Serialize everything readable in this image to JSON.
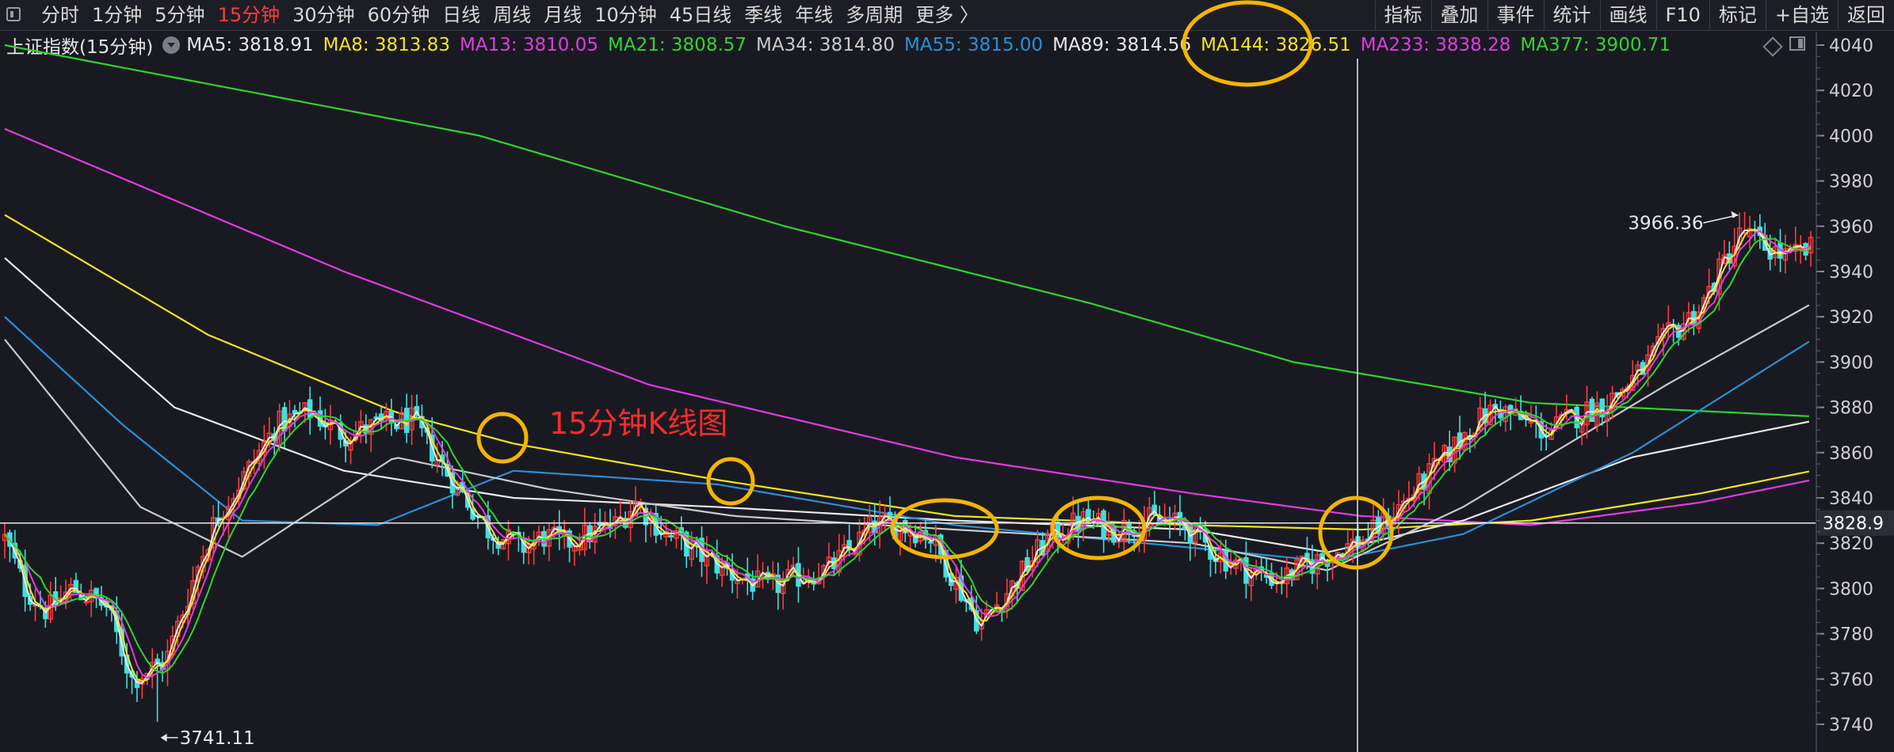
{
  "toolbar": {
    "periods": [
      {
        "label": "分时",
        "active": false
      },
      {
        "label": "1分钟",
        "active": false
      },
      {
        "label": "5分钟",
        "active": false
      },
      {
        "label": "15分钟",
        "active": true
      },
      {
        "label": "30分钟",
        "active": false
      },
      {
        "label": "60分钟",
        "active": false
      },
      {
        "label": "日线",
        "active": false
      },
      {
        "label": "周线",
        "active": false
      },
      {
        "label": "月线",
        "active": false
      },
      {
        "label": "10分钟",
        "active": false
      },
      {
        "label": "45日线",
        "active": false
      },
      {
        "label": "季线",
        "active": false
      },
      {
        "label": "年线",
        "active": false
      },
      {
        "label": "多周期",
        "active": false
      },
      {
        "label": "更多 〉",
        "active": false
      }
    ],
    "tools": [
      "指标",
      "叠加",
      "事件",
      "统计",
      "画线",
      "F10",
      "标记",
      "+自选",
      "返回"
    ]
  },
  "chart_title": "上证指数(15分钟)",
  "ma_legend": [
    {
      "label": "MA5: 3818.91",
      "color": "#e8e8e8"
    },
    {
      "label": "MA8: 3813.83",
      "color": "#f2e31c"
    },
    {
      "label": "MA13: 3810.05",
      "color": "#e13ae1"
    },
    {
      "label": "MA21: 3808.57",
      "color": "#2fd42f"
    },
    {
      "label": "MA34: 3814.80",
      "color": "#c9c9c9"
    },
    {
      "label": "MA55: 3815.00",
      "color": "#2a8fd6"
    },
    {
      "label": "MA89: 3814.56",
      "color": "#e8e8e8"
    },
    {
      "label": "MA144: 3826.51",
      "color": "#f2e31c"
    },
    {
      "label": "MA233: 3838.28",
      "color": "#e13ae1"
    },
    {
      "label": "MA377: 3900.71",
      "color": "#2fd42f"
    }
  ],
  "annotation_text": "15分钟K线图",
  "current_price_tag": "3828.9",
  "high_label": "3966.36",
  "low_label": "3741.11",
  "colors": {
    "up": "#ff3b3b",
    "down": "#3fe0e0",
    "circle": "#f5b400",
    "crosshair": "#e8e8e8"
  },
  "chart_data": {
    "type": "candlestick",
    "ylim": [
      3735,
      4048
    ],
    "y_ticks": [
      3740,
      3760,
      3780,
      3800,
      3820,
      3840,
      3860,
      3880,
      3900,
      3920,
      3940,
      3960,
      3980,
      4000,
      4020,
      4040
    ],
    "current_price": 3828.9,
    "high": 3966.36,
    "low": 3741.11,
    "price_path": [
      [
        0,
        3822
      ],
      [
        12,
        3800
      ],
      [
        25,
        3790
      ],
      [
        40,
        3800
      ],
      [
        60,
        3792
      ],
      [
        75,
        3760
      ],
      [
        95,
        3768
      ],
      [
        115,
        3812
      ],
      [
        125,
        3832
      ],
      [
        140,
        3848
      ],
      [
        160,
        3872
      ],
      [
        180,
        3878
      ],
      [
        200,
        3868
      ],
      [
        220,
        3872
      ],
      [
        240,
        3874
      ],
      [
        262,
        3850
      ],
      [
        285,
        3826
      ],
      [
        305,
        3818
      ],
      [
        318,
        3823
      ],
      [
        330,
        3820
      ],
      [
        345,
        3824
      ],
      [
        360,
        3828
      ],
      [
        372,
        3838
      ],
      [
        390,
        3824
      ],
      [
        410,
        3815
      ],
      [
        430,
        3806
      ],
      [
        450,
        3800
      ],
      [
        470,
        3806
      ],
      [
        485,
        3808
      ],
      [
        500,
        3818
      ],
      [
        512,
        3828
      ],
      [
        528,
        3828
      ],
      [
        545,
        3824
      ],
      [
        560,
        3804
      ],
      [
        575,
        3784
      ],
      [
        595,
        3802
      ],
      [
        615,
        3822
      ],
      [
        635,
        3830
      ],
      [
        655,
        3826
      ],
      [
        675,
        3830
      ],
      [
        695,
        3828
      ],
      [
        715,
        3815
      ],
      [
        735,
        3807
      ],
      [
        752,
        3804
      ],
      [
        770,
        3811
      ],
      [
        790,
        3818
      ],
      [
        805,
        3823
      ],
      [
        825,
        3838
      ],
      [
        845,
        3854
      ],
      [
        865,
        3872
      ],
      [
        880,
        3880
      ],
      [
        895,
        3874
      ],
      [
        910,
        3869
      ],
      [
        925,
        3876
      ],
      [
        945,
        3882
      ],
      [
        965,
        3896
      ],
      [
        980,
        3911
      ],
      [
        1000,
        3924
      ],
      [
        1015,
        3946
      ],
      [
        1025,
        3958
      ],
      [
        1035,
        3952
      ],
      [
        1052,
        3946
      ],
      [
        1066,
        3950
      ]
    ],
    "trend_lines": [
      {
        "name": "MA377",
        "color": "#2fd42f",
        "points": [
          [
            0,
            4040
          ],
          [
            280,
            4000
          ],
          [
            460,
            3960
          ],
          [
            640,
            3926
          ],
          [
            760,
            3900
          ],
          [
            900,
            3882
          ],
          [
            1066,
            3876
          ]
        ]
      },
      {
        "name": "MA233",
        "color": "#e13ae1",
        "points": [
          [
            0,
            4003
          ],
          [
            200,
            3940
          ],
          [
            380,
            3890
          ],
          [
            560,
            3858
          ],
          [
            700,
            3842
          ],
          [
            800,
            3832
          ],
          [
            900,
            3828
          ],
          [
            1000,
            3838
          ],
          [
            1066,
            3848
          ]
        ]
      },
      {
        "name": "MA144",
        "color": "#f2e31c",
        "points": [
          [
            0,
            3965
          ],
          [
            120,
            3912
          ],
          [
            230,
            3878
          ],
          [
            300,
            3864
          ],
          [
            420,
            3848
          ],
          [
            560,
            3832
          ],
          [
            700,
            3828
          ],
          [
            800,
            3826
          ],
          [
            900,
            3830
          ],
          [
            1000,
            3842
          ],
          [
            1066,
            3852
          ]
        ]
      },
      {
        "name": "MA89",
        "color": "#e8e8e8",
        "points": [
          [
            0,
            3946
          ],
          [
            100,
            3880
          ],
          [
            200,
            3852
          ],
          [
            300,
            3840
          ],
          [
            420,
            3836
          ],
          [
            560,
            3830
          ],
          [
            700,
            3826
          ],
          [
            780,
            3816
          ],
          [
            860,
            3830
          ],
          [
            960,
            3858
          ],
          [
            1066,
            3874
          ]
        ]
      },
      {
        "name": "MA55",
        "color": "#2a8fd6",
        "points": [
          [
            0,
            3920
          ],
          [
            70,
            3872
          ],
          [
            140,
            3830
          ],
          [
            220,
            3828
          ],
          [
            300,
            3852
          ],
          [
            420,
            3846
          ],
          [
            560,
            3828
          ],
          [
            700,
            3818
          ],
          [
            780,
            3812
          ],
          [
            860,
            3824
          ],
          [
            960,
            3860
          ],
          [
            1066,
            3910
          ]
        ]
      },
      {
        "name": "MA34",
        "color": "#c9c9c9",
        "points": [
          [
            0,
            3910
          ],
          [
            80,
            3836
          ],
          [
            140,
            3814
          ],
          [
            230,
            3858
          ],
          [
            320,
            3844
          ],
          [
            430,
            3832
          ],
          [
            560,
            3826
          ],
          [
            700,
            3820
          ],
          [
            780,
            3808
          ],
          [
            860,
            3836
          ],
          [
            980,
            3890
          ],
          [
            1066,
            3926
          ]
        ]
      }
    ],
    "ma_levels": [
      {
        "name": "MA5",
        "value": 3818.91
      },
      {
        "name": "MA8",
        "value": 3813.83
      },
      {
        "name": "MA13",
        "value": 3810.05
      },
      {
        "name": "MA21",
        "value": 3808.57
      },
      {
        "name": "MA34",
        "value": 3814.8
      },
      {
        "name": "MA55",
        "value": 3815.0
      },
      {
        "name": "MA89",
        "value": 3814.56
      },
      {
        "name": "MA144",
        "value": 3826.51
      },
      {
        "name": "MA233",
        "value": 3838.28
      },
      {
        "name": "MA377",
        "value": 3900.71
      }
    ]
  }
}
